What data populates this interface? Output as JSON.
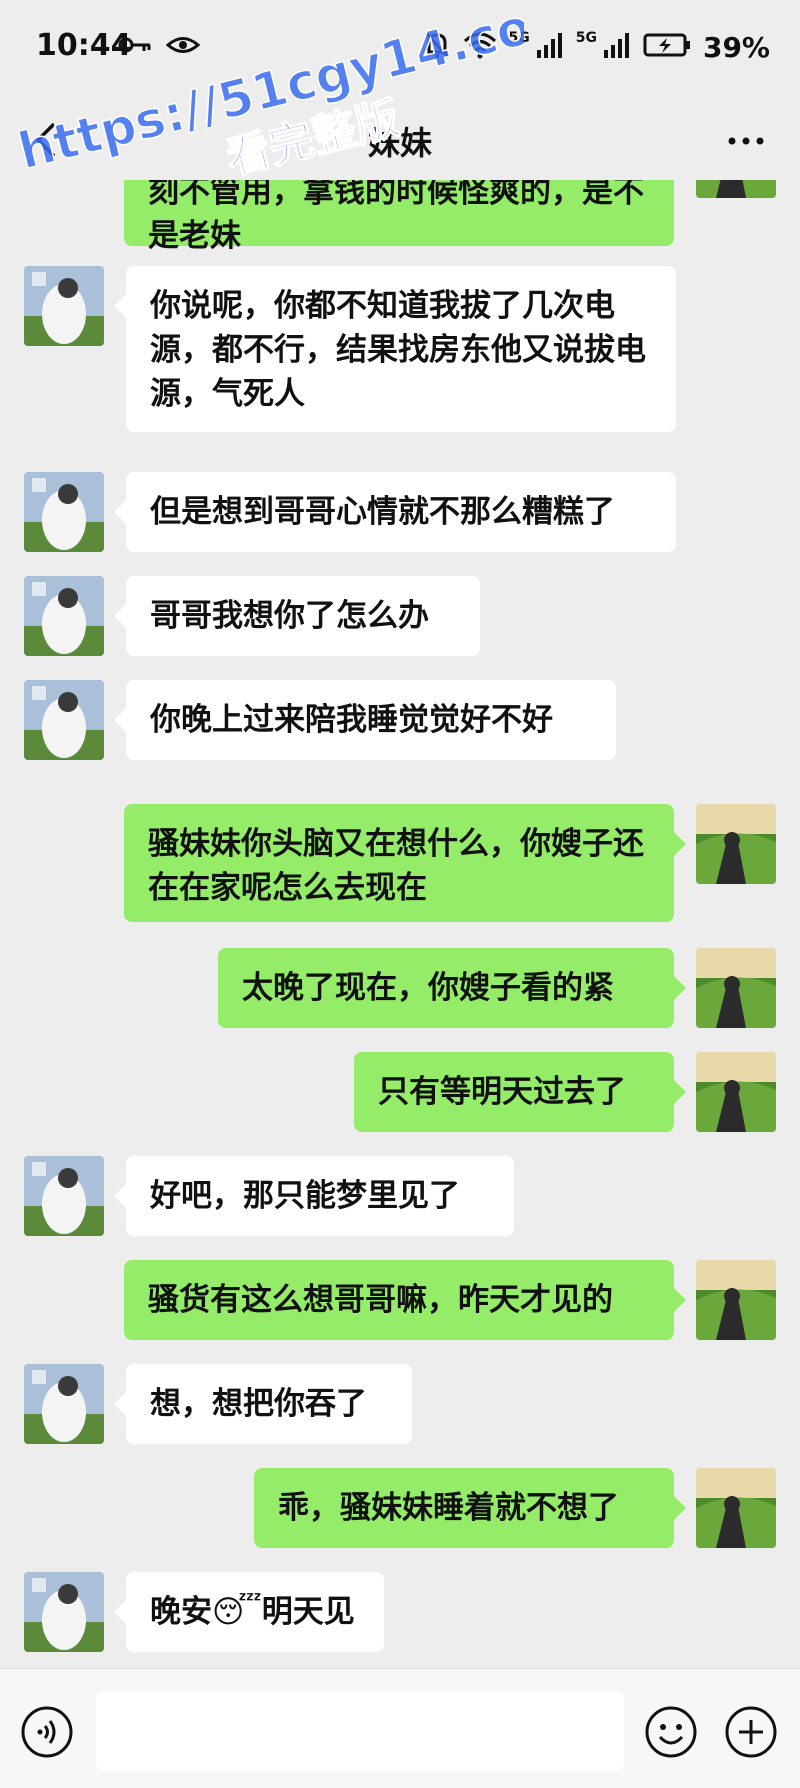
{
  "status_bar": {
    "time": "10:44",
    "network_a": "5G",
    "network_b": "5G",
    "battery": "39%"
  },
  "nav": {
    "title": "妹妹"
  },
  "watermark": {
    "line1": "https://51cgy14.com",
    "line2": "看完整版"
  },
  "messages": [
    {
      "side": "out",
      "text": "刻不管用，拿钱的时候怪爽的，是不是老妹"
    },
    {
      "side": "in",
      "text": "你说呢，你都不知道我拔了几次电源，都不行，结果找房东他又说拔电源，气死人"
    },
    {
      "side": "in",
      "text": "但是想到哥哥心情就不那么糟糕了"
    },
    {
      "side": "in",
      "text": "哥哥我想你了怎么办"
    },
    {
      "side": "in",
      "text": "你晚上过来陪我睡觉觉好不好"
    },
    {
      "side": "out",
      "text": "骚妹妹你头脑又在想什么，你嫂子还在在家呢怎么去现在"
    },
    {
      "side": "out",
      "text": "太晚了现在，你嫂子看的紧"
    },
    {
      "side": "out",
      "text": "只有等明天过去了"
    },
    {
      "side": "in",
      "text": "好吧，那只能梦里见了"
    },
    {
      "side": "out",
      "text": "骚货有这么想哥哥嘛，昨天才见的"
    },
    {
      "side": "in",
      "text": "想，想把你吞了"
    },
    {
      "side": "out",
      "text": "乖，骚妹妹睡着就不想了"
    },
    {
      "side": "in",
      "text": "晚安😴明天见"
    }
  ],
  "input_bar": {
    "voice_icon": "voice-icon",
    "emoji_icon": "emoji-icon",
    "plus_icon": "plus-icon",
    "placeholder": ""
  },
  "colors": {
    "background": "#ededed",
    "outgoing_bubble": "#95ec69",
    "incoming_bubble": "#ffffff",
    "watermark": "#3a6df0"
  }
}
